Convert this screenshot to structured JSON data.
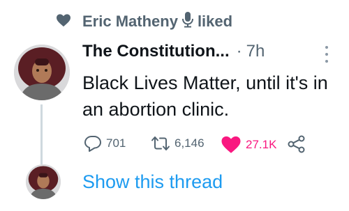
{
  "liked_by": {
    "name": "Eric Matheny",
    "suffix": "liked",
    "icon": "heart-icon",
    "badge_icon": "microphone-icon"
  },
  "tweet": {
    "author": "The Constitution...",
    "separator": "·",
    "time": "7h",
    "text": "Black Lives Matter, until it's in an abortion clinic.",
    "actions": {
      "reply_count": "701",
      "retweet_count": "6,146",
      "like_count": "27.1K"
    }
  },
  "show_thread": "Show this thread",
  "colors": {
    "accent": "#1d9bf0",
    "like": "#f91880",
    "muted": "#536471"
  }
}
